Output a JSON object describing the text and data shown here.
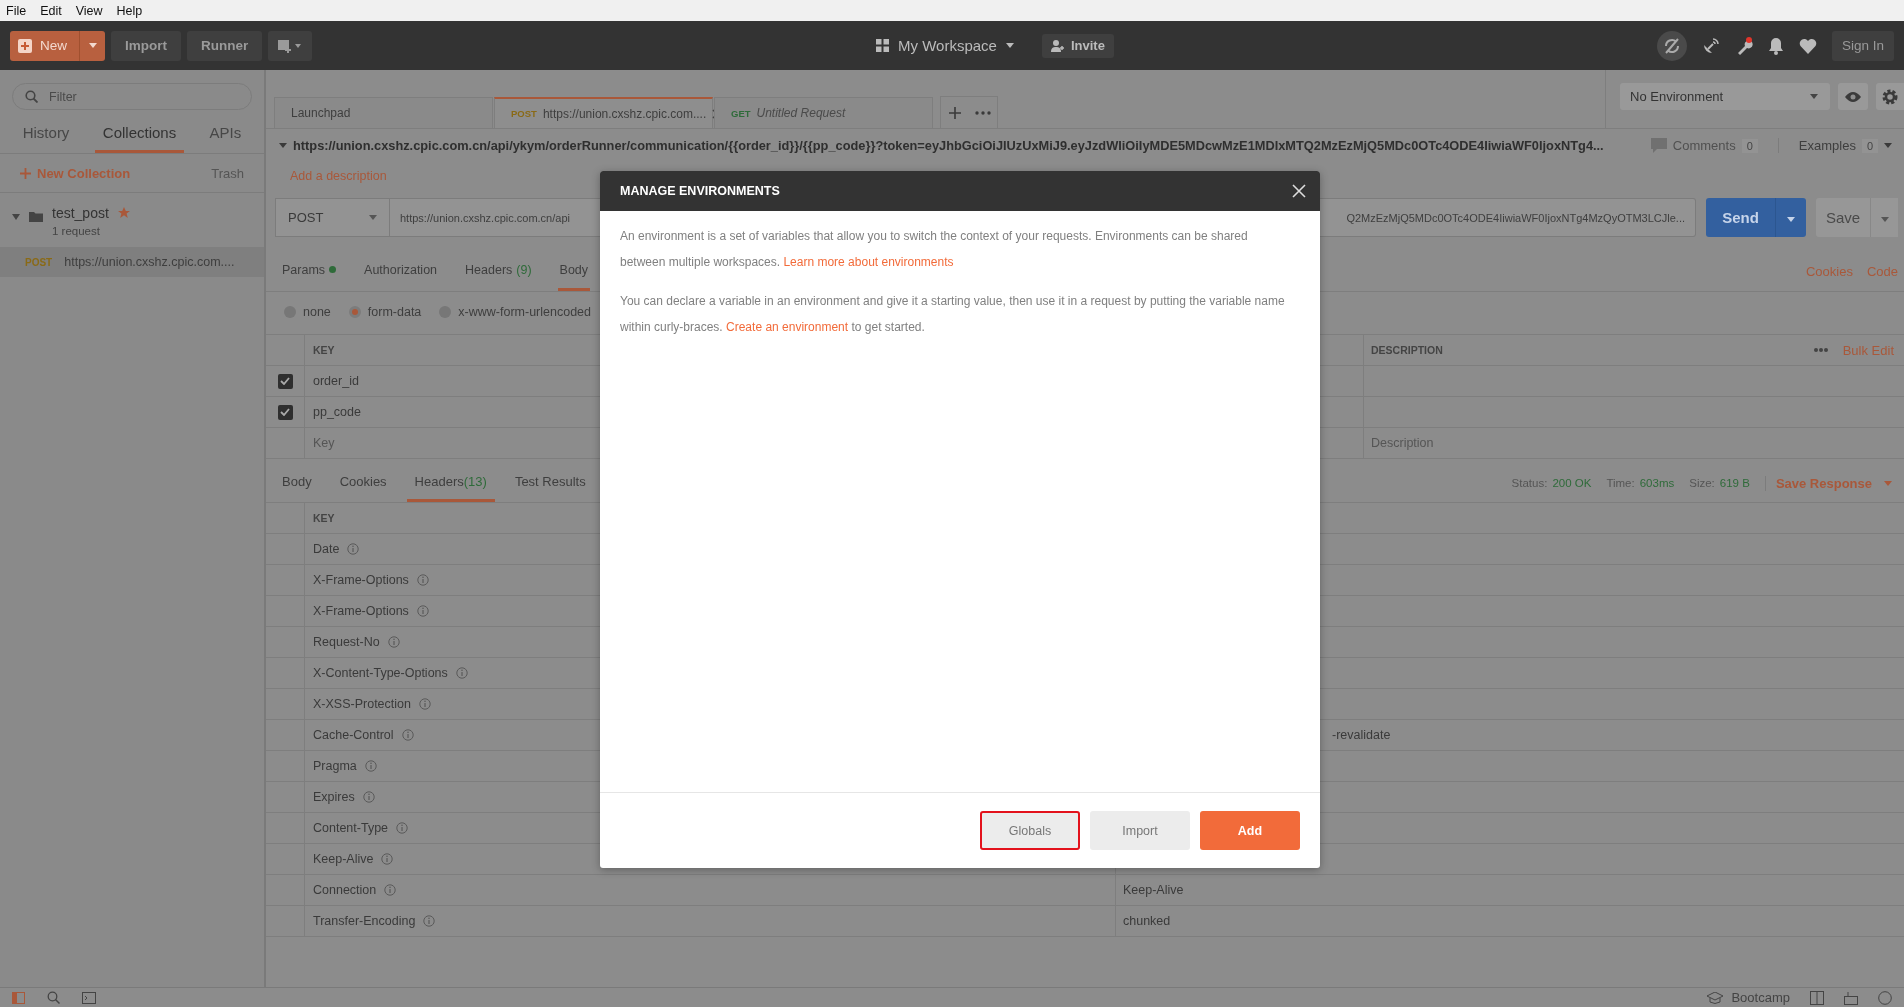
{
  "menu_bar": [
    "File",
    "Edit",
    "View",
    "Help"
  ],
  "header": {
    "new_button": "New",
    "buttons": [
      "Import",
      "Runner"
    ],
    "workspace": "My Workspace",
    "invite": "Invite",
    "sign_in": "Sign In",
    "notification_dot": true
  },
  "sidebar": {
    "filter_placeholder": "Filter",
    "tabs": [
      {
        "label": "History",
        "selected": false
      },
      {
        "label": "Collections",
        "selected": true
      },
      {
        "label": "APIs",
        "selected": false
      }
    ],
    "new_collection": "New Collection",
    "trash": "Trash",
    "collections": [
      {
        "name": "test_post",
        "starred": true,
        "count": "1 request",
        "expanded": true,
        "requests": [
          {
            "method": "POST",
            "url": "https://union.cxshz.cpic.com....",
            "selected": true
          }
        ]
      }
    ]
  },
  "request_tabs": [
    {
      "title": "Launchpad",
      "selected": false,
      "unsaved": false
    },
    {
      "method": "POST",
      "title": "https://union.cxshz.cpic.com....",
      "selected": true,
      "unsaved": false
    },
    {
      "method": "GET",
      "title": "Untitled Request",
      "selected": false,
      "unsaved": true
    }
  ],
  "environment": {
    "selected": "No Environment"
  },
  "request": {
    "title": "https://union.cxshz.cpic.com.cn/api/ykym/orderRunner/communication/{{order_id}}/{{pp_code}}?token=eyJhbGciOiJIUzUxMiJ9.eyJzdWIiOiIyMDE5MDcwMzE1MDIxMTQ2MzEzMjQ5MDc0OTc4ODE4IiwiaWF0IjoxNTg4...",
    "add_description": "Add a description",
    "comments": "Comments",
    "comments_count": "0",
    "examples": "Examples",
    "examples_count": "0",
    "method": "POST",
    "url_start": "https://union.cxshz.cpic.com.cn/api",
    "url_end": "Q2MzEzMjQ5MDc0OTc4ODE4IiwiaWF0IjoxNTg4MzQyOTM3LCJle...",
    "send": "Send",
    "save": "Save"
  },
  "request_sections": {
    "tabs": [
      {
        "label": "Params",
        "dot": true,
        "selected": false
      },
      {
        "label": "Authorization",
        "dot": false,
        "selected": false
      },
      {
        "label": "Headers",
        "count": "(9)",
        "dot": false,
        "selected": false
      },
      {
        "label": "Body",
        "dot": false,
        "selected": true
      }
    ],
    "links": [
      "Cookies",
      "Code"
    ]
  },
  "body_modes": [
    {
      "label": "none",
      "selected": false
    },
    {
      "label": "form-data",
      "selected": true
    },
    {
      "label": "x-www-form-urlencoded",
      "selected": false
    }
  ],
  "form_table": {
    "key_column": "KEY",
    "description_column": "DESCRIPTION",
    "bulk_edit": "Bulk Edit",
    "rows": [
      {
        "key": "order_id",
        "checked": true
      },
      {
        "key": "pp_code",
        "checked": true
      }
    ],
    "key_placeholder": "Key",
    "description_placeholder": "Description"
  },
  "response": {
    "tabs": [
      {
        "label": "Body",
        "selected": false
      },
      {
        "label": "Cookies",
        "selected": false
      },
      {
        "label": "Headers",
        "count": "(13)",
        "selected": true
      },
      {
        "label": "Test Results",
        "selected": false
      }
    ],
    "status_label": "Status:",
    "status": "200 OK",
    "time_label": "Time:",
    "time": "603ms",
    "size_label": "Size:",
    "size": "619 B",
    "save_response": "Save Response",
    "key_column": "KEY",
    "headers": [
      {
        "key": "Date"
      },
      {
        "key": "X-Frame-Options"
      },
      {
        "key": "X-Frame-Options"
      },
      {
        "key": "Request-No"
      },
      {
        "key": "X-Content-Type-Options"
      },
      {
        "key": "X-XSS-Protection"
      },
      {
        "key": "Cache-Control",
        "value": "-revalidate",
        "value_cut": true
      },
      {
        "key": "Pragma"
      },
      {
        "key": "Expires"
      },
      {
        "key": "Content-Type"
      },
      {
        "key": "Keep-Alive"
      },
      {
        "key": "Connection",
        "value": "Keep-Alive"
      },
      {
        "key": "Transfer-Encoding",
        "value": "chunked"
      }
    ]
  },
  "status_bar": {
    "bootcamp": "Bootcamp"
  },
  "modal": {
    "title": "MANAGE ENVIRONMENTS",
    "paragraphs": [
      {
        "text": "An environment is a set of variables that allow you to switch the context of your requests. Environments can be shared between multiple workspaces.",
        "link": "Learn more about environments"
      },
      {
        "text": "You can declare a variable in an environment and give it a starting value, then use it in a request by putting the variable name within curly-braces.",
        "link": "Create an environment",
        "after": "to get started."
      }
    ],
    "buttons": [
      {
        "label": "Globals",
        "kind": "secondary",
        "highlighted": true
      },
      {
        "label": "Import",
        "kind": "secondary",
        "highlighted": false
      },
      {
        "label": "Add",
        "kind": "primary",
        "highlighted": false
      }
    ]
  }
}
